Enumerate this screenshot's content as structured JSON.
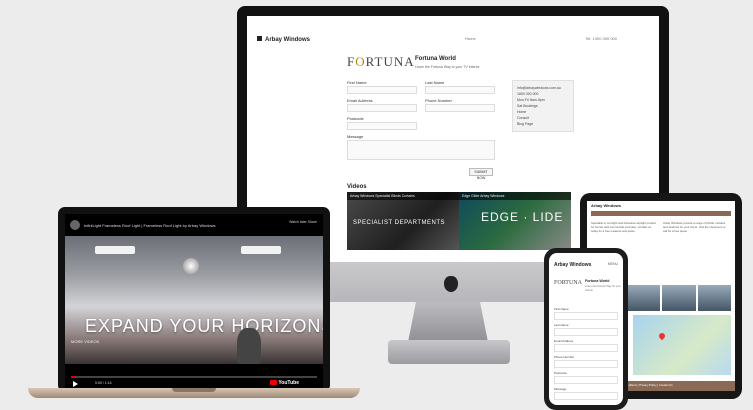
{
  "imac": {
    "brand": "Arbay Windows",
    "nav_mid": "Home",
    "nav_right": "Tel: 1300 300 000",
    "logo_text_1": "F",
    "logo_text_2": "RTUNA",
    "title": "Fortuna World",
    "subtitle": "Learn the Fortuna Way to your TV Interior",
    "form_labels": {
      "first_name": "First Name",
      "last_name": "Last Name",
      "email": "Email Address",
      "phone": "Phone Number",
      "postcode": "Postcode",
      "message": "Message"
    },
    "contact_lines": [
      "info@arbaywindows.com.au",
      "1800 000 000",
      "Mon-Fri 8am-5pm",
      "Sat Bookings",
      "Home",
      "Consult",
      "Blog Page"
    ],
    "submit_label": "SUBMIT NOW",
    "videos_label": "Videos",
    "video1_bar": "Arbay Windows Specialist Blinds Curtains",
    "video1_text": "SPECIALIST DEPARTMENTS",
    "video2_bar": "Edge Glide Arbay Windows",
    "video2_text": "EDGE · LIDE"
  },
  "macbook": {
    "video_title": "InfiniLight Frameless Roof Light | Frameless Roof Light by Arbay Windows",
    "actions": "Watch later   Share",
    "hero_text": "EXPAND YOUR HORIZONS",
    "more_videos": "MORE VIDEOS",
    "time": "0:00 / 1:14",
    "yt_label": "YouTube",
    "progress": 0.02
  },
  "ipad": {
    "brand": "Arbay Windows",
    "col_left": "Specialist in roof light and frameless skylight product for homes and commercial premises. Contact us today for a free measure and quote.",
    "col_right": "Arbay Windows provide a range of blinds, curtains and windows for your home. Visit the showroom or call for a free quote.",
    "footer": "Arbay Windows | Terms & Conditions | Privacy Policy | Contact Us"
  },
  "iphone": {
    "brand": "Arbay Windows",
    "menu": "MENU",
    "logo": "FORTUNA",
    "title": "Fortuna World",
    "subtitle": "Learn the Fortuna Way for your Interior",
    "labels": [
      "First Name",
      "Last Name",
      "Email Address",
      "Phone Number",
      "Postcode",
      "Message"
    ]
  }
}
